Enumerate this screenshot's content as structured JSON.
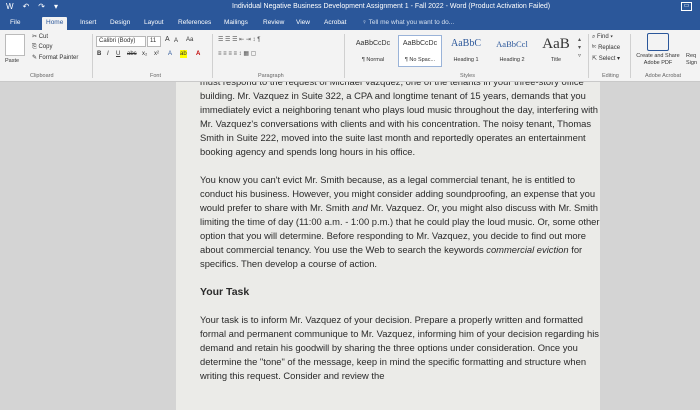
{
  "window": {
    "title": "Individual Negative Business Development Assignment 1 - Fall 2022 - Word (Product Activation Failed)",
    "qat": [
      "W",
      "↶",
      "↷",
      "▾"
    ]
  },
  "tabs": [
    "File",
    "Home",
    "Insert",
    "Design",
    "Layout",
    "References",
    "Mailings",
    "Review",
    "View",
    "Acrobat"
  ],
  "tell_me": "Tell me what you want to do...",
  "ribbon": {
    "clipboard": {
      "paste": "Paste",
      "cut": "Cut",
      "copy": "Copy",
      "format_painter": "Format Painter",
      "label": "Clipboard"
    },
    "font": {
      "name": "Calibri (Body)",
      "size": "11",
      "grow": "A",
      "shrink": "A",
      "case": "Aa",
      "bold": "B",
      "italic": "I",
      "underline": "U",
      "strike": "abc",
      "subscript": "x₂",
      "superscript": "x²",
      "effects": "A",
      "highlight": "ab",
      "color": "A",
      "label": "Font"
    },
    "paragraph": {
      "label": "Paragraph"
    },
    "styles": {
      "items": [
        {
          "sample": "AaBbCcDc",
          "name": "¶ Normal"
        },
        {
          "sample": "AaBbCcDc",
          "name": "¶ No Spac..."
        },
        {
          "sample": "AaBbC",
          "name": "Heading 1"
        },
        {
          "sample": "AaBbCcl",
          "name": "Heading 2"
        },
        {
          "sample": "AaB",
          "name": "Title"
        }
      ],
      "label": "Styles"
    },
    "editing": {
      "find": "Find",
      "replace": "Replace",
      "select": "Select",
      "label": "Editing"
    },
    "acrobat": {
      "create_share": "Create and Share Adobe PDF",
      "request": "Req Sign",
      "label": "Adobe Acrobat"
    }
  },
  "document": {
    "para1": "must respond to the request of Michael Vazquez, one of the tenants in your three-story office building. Mr. Vazquez in Suite 322, a CPA and longtime tenant of 15 years, demands that you immediately evict a neighboring tenant who plays loud music throughout the day, interfering with Mr. Vazquez's conversations with clients and with his concentration. The noisy tenant, Thomas Smith in Suite 222, moved into the suite last month and reportedly operates an entertainment booking agency and spends long hours in his office.",
    "para2_a": "You know you can't evict Mr. Smith because, as a legal commercial tenant, he is entitled to conduct his business. However, you might consider adding soundproofing, an expense that you would prefer to share with Mr. Smith ",
    "para2_and": "and",
    "para2_b": " Mr. Vazquez. Or, you might also discuss with Mr. Smith limiting the time of day (11:00 a.m. - 1:00 p.m.) that he could play the loud music. Or, some other option that you will determine. Before responding to Mr. Vazquez, you decide to find out more about commercial tenancy. You use the Web to search the keywords ",
    "para2_keywords": "commercial eviction",
    "para2_c": " for specifics. Then develop a course of action.",
    "heading": "Your Task",
    "para3": "Your task is to inform Mr. Vazquez of your decision. Prepare a properly written and formatted formal and permanent communique to Mr. Vazquez, informing him of your decision regarding his demand and retain his goodwill by sharing the three options under consideration. Once you determine the \"tone\" of the message, keep in mind the specific formatting and structure when writing this request. Consider and review the"
  },
  "colors": {
    "word_blue": "#2b579a",
    "ribbon_bg": "#f3f3f3",
    "page_bg": "#ebebe8"
  }
}
